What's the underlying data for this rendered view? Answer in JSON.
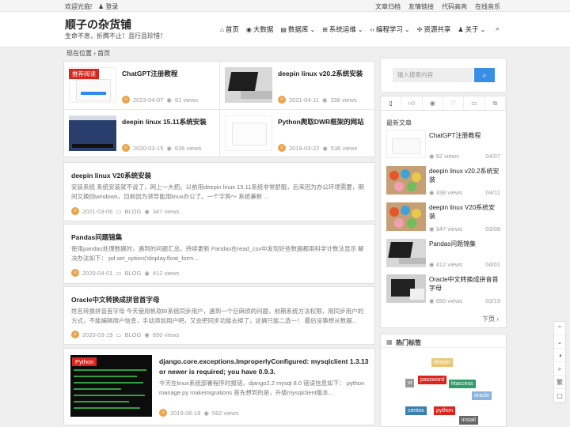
{
  "topbar": {
    "welcome": "欢迎光临!",
    "login": "登录",
    "links": [
      "文章归档",
      "友情链接",
      "代码高亮",
      "在线音乐"
    ]
  },
  "header": {
    "site_title": "顺子の杂货铺",
    "site_subtitle": "生命不息，折腾不止！且行且珍惜！",
    "nav": [
      {
        "label": "首页",
        "icon": "home-icon",
        "glyph": "⌂"
      },
      {
        "label": "大数据",
        "icon": "eye-icon",
        "glyph": "◉"
      },
      {
        "label": "数据库",
        "icon": "database-icon",
        "glyph": "▤",
        "dropdown": true
      },
      {
        "label": "系统运维",
        "icon": "windows-icon",
        "glyph": "⊞",
        "dropdown": true
      },
      {
        "label": "编程学习",
        "icon": "code-icon",
        "glyph": "‹›",
        "dropdown": true
      },
      {
        "label": "资源共享",
        "icon": "share-icon",
        "glyph": "✣"
      },
      {
        "label": "关于",
        "icon": "user-icon",
        "glyph": "♟",
        "dropdown": true
      }
    ]
  },
  "breadcrumb": {
    "label": "现在位置",
    "home": "首页"
  },
  "featured": [
    {
      "title": "ChatGPT注册教程",
      "date": "2023-04-07",
      "views": "91 views",
      "badge": "推荐阅读"
    },
    {
      "title": "deepin linux v20.2系统安装",
      "date": "2021-04-11",
      "views": "338 views"
    },
    {
      "title": "deepin linux 15.11系统安装",
      "date": "2020-03-15",
      "views": "636 views"
    },
    {
      "title": "Python爬取DWR框架的网站",
      "date": "2019-03-22",
      "views": "536 views"
    }
  ],
  "posts": [
    {
      "title": "deepin linux V20系统安装",
      "excerpt": "安装系统 系统安装就不说了，网上一大把。以前用deepin linux 15.11系统非常舒服，后来因为办公环境需要，期间又换回windows，目前因为领导能用linux办公了。一个字爽～ 系统兼新 ...",
      "date": "2021-03-06",
      "category": "BLOG",
      "views": "347 views"
    },
    {
      "title": "Pandas问题锦集",
      "excerpt": "使用pandas处理数据时，遇到的问题汇总。持续更新 Pandas在read_csv中发现好些数据都用科学计数法显示 解决办法如下： pd.set_option('display.float_form...",
      "date": "2020-04-01",
      "category": "BLOG",
      "views": "412 views"
    },
    {
      "title": "Oracle中文转换成拼音首字母",
      "excerpt": "姓名转换拼音首字母 今天使用帆软BI系统同步用户，遇到一个巨麻烦的问题，前期系统方法权限，用同步用户的方式，不能编辑用户信息，手动添加用户吧，又会把同步功能去掉了，这俩只能二选一！ 最后没事想从数据...",
      "date": "2020-03-19",
      "category": "BLOG",
      "views": "650 views"
    },
    {
      "title": "django.core.exceptions.ImproperlyConfigured: mysqlclient 1.3.13 or newer is required; you have 0.9.3.",
      "excerpt": "今天在linux系统部署程序时报错，django2.2 mysql 8.0 错误信息如下： python manage.py makemigrations 首先想到的是，升级mysqlclient版本...",
      "date": "2019-06-18",
      "views": "562 views",
      "badge": "Python"
    }
  ],
  "sidebar": {
    "search_placeholder": "输入搜索内容",
    "tabs": [
      "file-icon",
      "thumb-icon",
      "eye-icon",
      "heart-icon",
      "comment-icon",
      "copy-icon"
    ],
    "latest_heading": "最新文章",
    "latest": [
      {
        "title": "ChatGPT注册教程",
        "views": "92 views",
        "date": "04/07"
      },
      {
        "title": "deepin linux v20.2系统安装",
        "views": "338 views",
        "date": "04/11"
      },
      {
        "title": "deepin linux V20系统安装",
        "views": "347 views",
        "date": "03/08"
      },
      {
        "title": "Pandas问题锦集",
        "views": "412 views",
        "date": "04/01"
      },
      {
        "title": "Oracle中文转换成拼音首字母",
        "views": "650 views",
        "date": "03/19"
      }
    ],
    "next_page": "下页",
    "hot_tags_heading": "热门标签",
    "tags": [
      {
        "label": "deepin",
        "color": "#e8c77a"
      },
      {
        "label": "vi",
        "color": "#999999"
      },
      {
        "label": "password",
        "color": "#d9251d"
      },
      {
        "label": "htaccess",
        "color": "#2e9e6b"
      },
      {
        "label": "oracle",
        "color": "#8ab4e0"
      },
      {
        "label": "centos",
        "color": "#3a7fb0"
      },
      {
        "label": "python",
        "color": "#d9251d"
      },
      {
        "label": "install",
        "color": "#666666"
      }
    ]
  },
  "float_bar": [
    "◑",
    "⌕",
    "繁",
    "▢"
  ]
}
